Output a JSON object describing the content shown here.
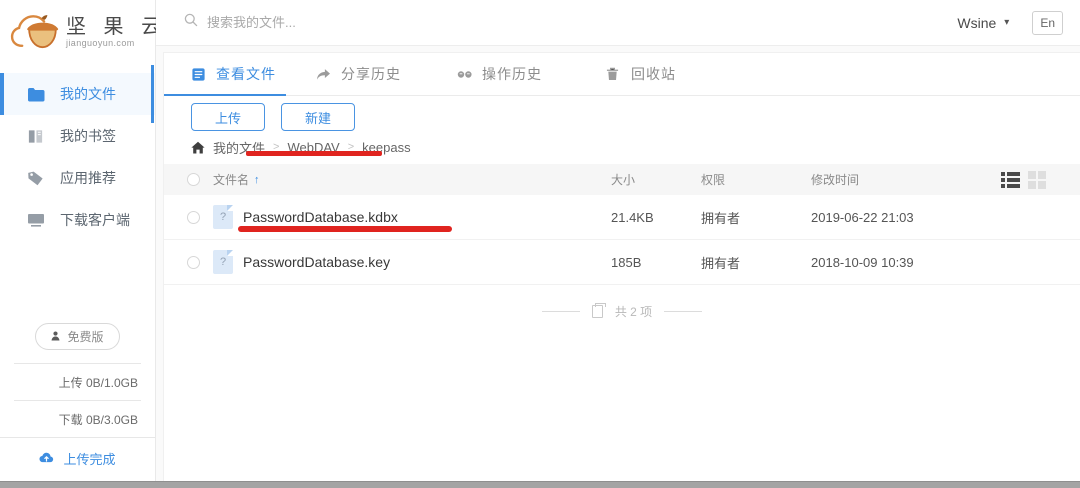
{
  "brand": {
    "name": "坚 果 云",
    "domain": "jianguoyun.com"
  },
  "topbar": {
    "search_placeholder": "搜索我的文件...",
    "username": "Wsine",
    "user_caret": "▾",
    "lang_label": "En"
  },
  "sidebar": {
    "items": [
      {
        "label": "我的文件",
        "icon": "folder-icon",
        "active": true
      },
      {
        "label": "我的书签",
        "icon": "bookmark-icon",
        "active": false
      },
      {
        "label": "应用推荐",
        "icon": "tag-icon",
        "active": false
      },
      {
        "label": "下载客户端",
        "icon": "monitor-icon",
        "active": false
      }
    ],
    "plan_badge": "免费版",
    "upload_quota": "上传 0B/1.0GB",
    "download_quota": "下载 0B/3.0GB",
    "upload_status": "上传完成"
  },
  "tabs": [
    {
      "label": "查看文件",
      "icon": "file-list-icon",
      "active": true
    },
    {
      "label": "分享历史",
      "icon": "share-arrow-icon",
      "active": false
    },
    {
      "label": "操作历史",
      "icon": "history-icon",
      "active": false
    },
    {
      "label": "回收站",
      "icon": "trash-icon",
      "active": false
    }
  ],
  "actions": {
    "upload_label": "上传",
    "new_label": "新建"
  },
  "breadcrumb": {
    "separator": ">",
    "items": [
      "我的文件",
      "WebDAV",
      "keepass"
    ]
  },
  "table": {
    "headers": {
      "name": "文件名",
      "size": "大小",
      "permission": "权限",
      "modified": "修改时间"
    },
    "sort_indicator": "↑",
    "rows": [
      {
        "name": "PasswordDatabase.kdbx",
        "type_glyph": "?",
        "size": "21.4KB",
        "permission": "拥有者",
        "modified": "2019-06-22 21:03"
      },
      {
        "name": "PasswordDatabase.key",
        "type_glyph": "?",
        "size": "185B",
        "permission": "拥有者",
        "modified": "2018-10-09 10:39"
      }
    ],
    "footer_count": "共 2 项"
  },
  "colors": {
    "accent": "#3d8de0",
    "annotation": "#e0241f"
  }
}
